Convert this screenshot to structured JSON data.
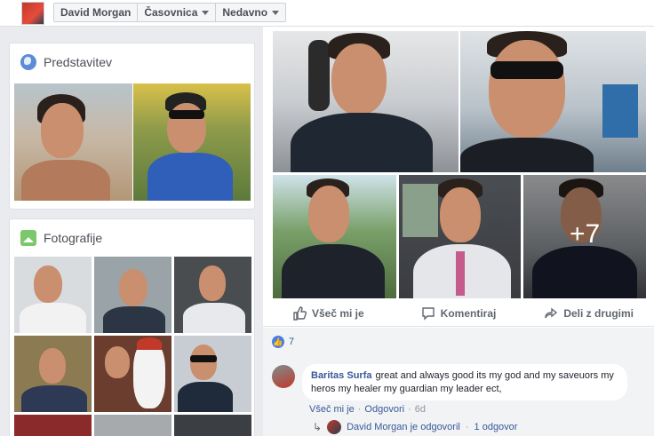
{
  "header": {
    "profile_name": "David Morgan",
    "crumb_timeline": "Časovnica",
    "crumb_recent": "Nedavno"
  },
  "intro_card": {
    "title": "Predstavitev"
  },
  "photos_card": {
    "title": "Fotografije"
  },
  "post": {
    "more_photos": "+7",
    "actions": {
      "like": "Všeč mi je",
      "comment": "Komentiraj",
      "share": "Deli z drugimi"
    },
    "like_count": "7",
    "comment": {
      "author": "Baritas Surfa",
      "text": "great and always good its my god and my saveuors my heros my healer my guardian my leader ect,",
      "like_link": "Všeč mi je",
      "reply_link": "Odgovori",
      "time": "6d"
    },
    "reply": {
      "author_text": "David Morgan je odgovoril",
      "separator": "·",
      "count_text": "1 odgovor"
    }
  },
  "colors": {
    "link": "#385898",
    "background": "#e9ebee",
    "like_blue": "#4a7de2"
  }
}
